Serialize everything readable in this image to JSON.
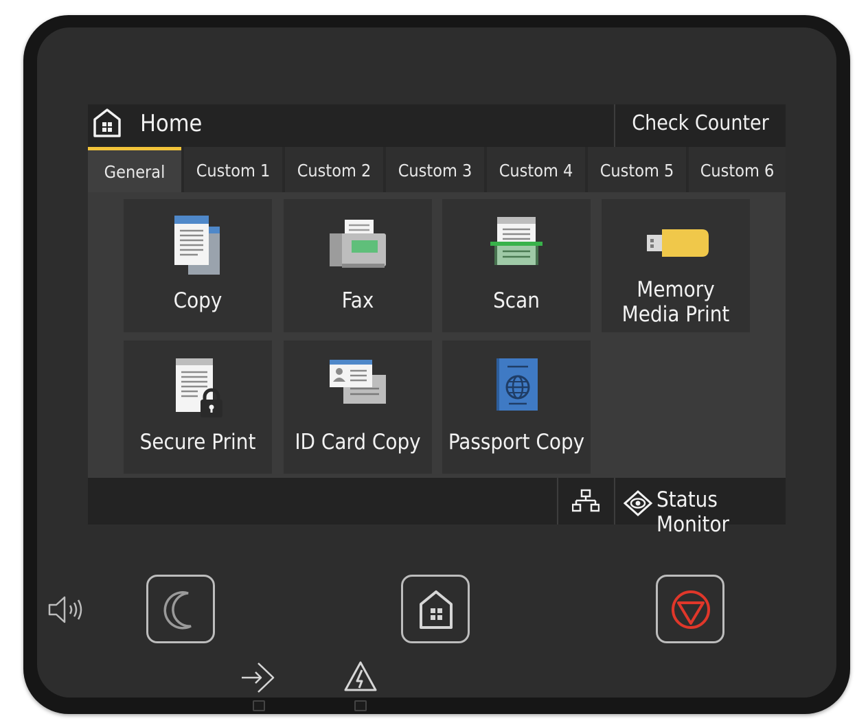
{
  "header": {
    "title": "Home",
    "check_counter": "Check Counter",
    "home_icon": "home-icon"
  },
  "tabs": [
    {
      "label": "General",
      "active": true
    },
    {
      "label": "Custom 1"
    },
    {
      "label": "Custom 2"
    },
    {
      "label": "Custom 3"
    },
    {
      "label": "Custom 4"
    },
    {
      "label": "Custom 5"
    },
    {
      "label": "Custom 6"
    }
  ],
  "tiles": [
    {
      "label": "Copy",
      "icon": "copy-icon"
    },
    {
      "label": "Fax",
      "icon": "fax-icon"
    },
    {
      "label": "Scan",
      "icon": "scan-icon"
    },
    {
      "label_line1": "Memory",
      "label_line2": "Media Print",
      "icon": "usb-memory-icon"
    },
    {
      "label": "Secure Print",
      "icon": "secure-print-icon"
    },
    {
      "label": "ID Card Copy",
      "icon": "id-card-icon"
    },
    {
      "label": "Passport Copy",
      "icon": "passport-icon"
    }
  ],
  "footer": {
    "network_icon": "network-icon",
    "status_monitor": "Status Monitor",
    "status_icon": "status-monitor-icon"
  },
  "hardware": {
    "energy_saver": "moon-icon",
    "home": "home-icon",
    "stop": "stop-icon",
    "volume": "speaker-icon",
    "data_indicator": "data-indicator-icon",
    "error_indicator": "warning-icon"
  },
  "colors": {
    "tab_accent": "#f2c43a",
    "stop_red": "#e0372a",
    "screen_bg": "#3b3b3b",
    "tile_bg": "#313131"
  }
}
